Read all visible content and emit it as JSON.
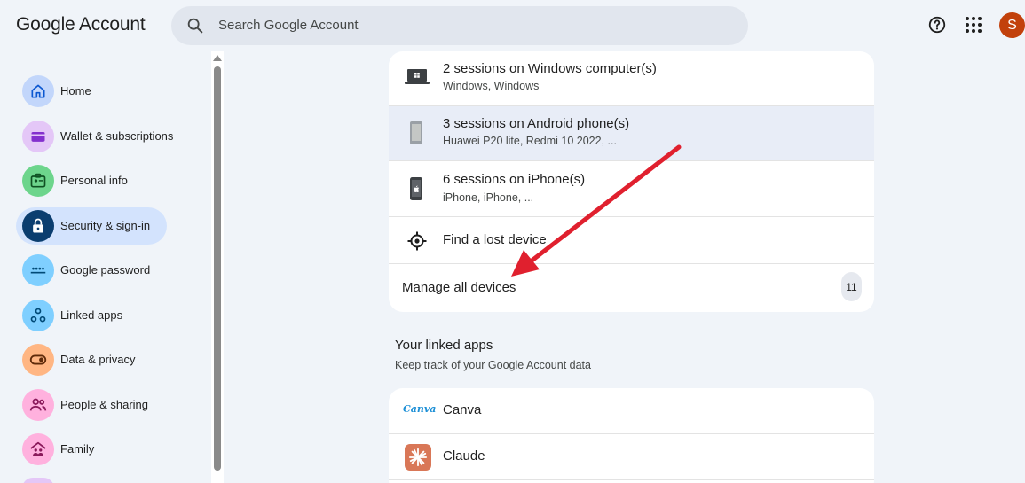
{
  "header": {
    "logo": "Google Account",
    "search_placeholder": "Search Google Account",
    "avatar_letter": "S"
  },
  "sidebar": {
    "items": [
      {
        "label": "Home",
        "icon": "home-icon"
      },
      {
        "label": "Wallet & subscriptions",
        "icon": "wallet-icon"
      },
      {
        "label": "Personal info",
        "icon": "id-card-icon"
      },
      {
        "label": "Security & sign-in",
        "icon": "lock-icon",
        "active": true
      },
      {
        "label": "Google password",
        "icon": "password-icon"
      },
      {
        "label": "Linked apps",
        "icon": "linked-apps-icon"
      },
      {
        "label": "Data & privacy",
        "icon": "toggle-icon"
      },
      {
        "label": "People & sharing",
        "icon": "people-icon"
      },
      {
        "label": "Family",
        "icon": "family-icon"
      }
    ]
  },
  "devices": {
    "rows": [
      {
        "title": "2 sessions on Windows computer(s)",
        "subtitle": "Windows, Windows",
        "icon": "laptop-icon"
      },
      {
        "title": "3 sessions on Android phone(s)",
        "subtitle": "Huawei P20 lite, Redmi 10 2022, ...",
        "icon": "android-phone-icon"
      },
      {
        "title": "6 sessions on iPhone(s)",
        "subtitle": "iPhone, iPhone, ...",
        "icon": "iphone-icon"
      },
      {
        "title": "Find a lost device",
        "icon": "locate-icon"
      }
    ],
    "manage_label": "Manage all devices",
    "manage_count": "11"
  },
  "linked_apps": {
    "title": "Your linked apps",
    "subtitle": "Keep track of your Google Account data",
    "apps": [
      {
        "name": "Canva",
        "logo_text": "Canva"
      },
      {
        "name": "Claude"
      }
    ]
  },
  "colors": {
    "background": "#f0f4f9",
    "active_nav": "#d3e3fd",
    "avatar": "#c2410c",
    "annotation_arrow": "#e0202e"
  }
}
